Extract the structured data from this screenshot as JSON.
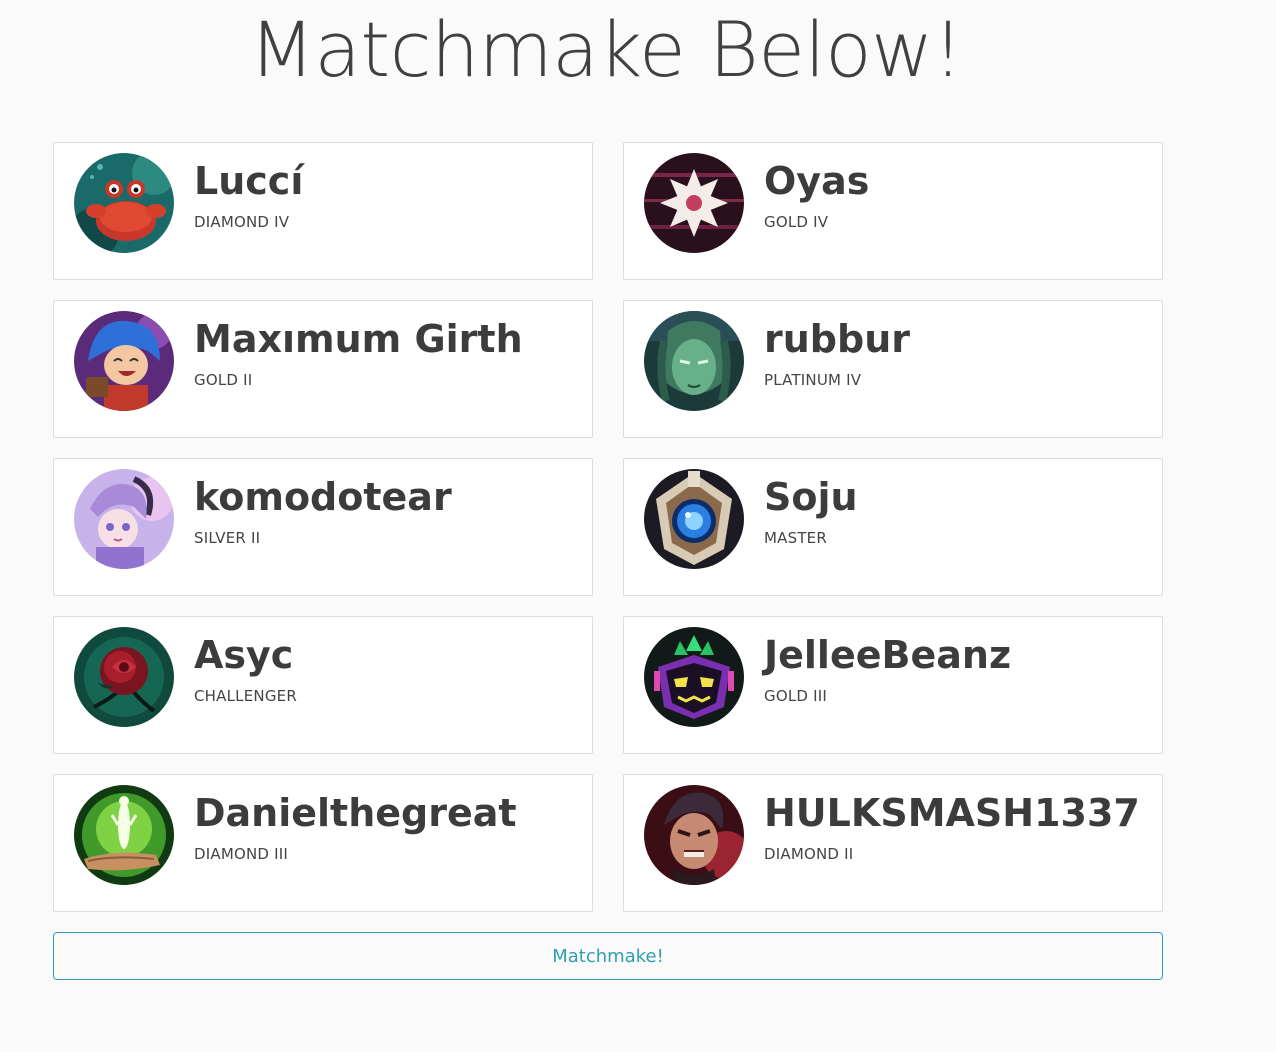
{
  "page": {
    "title": "Matchmake Below!",
    "accent_color": "#2e9fb4"
  },
  "players": [
    {
      "name": "Luccí",
      "rank": "DIAMOND IV",
      "icon": "crab-icon"
    },
    {
      "name": "Oyas",
      "rank": "GOLD IV",
      "icon": "sun-emblem-icon"
    },
    {
      "name": "Maxımum Girth",
      "rank": "GOLD II",
      "icon": "blue-hair-champion-icon"
    },
    {
      "name": "rubbur",
      "rank": "PLATINUM IV",
      "icon": "green-face-icon"
    },
    {
      "name": "komodotear",
      "rank": "SILVER II",
      "icon": "horned-girl-icon"
    },
    {
      "name": "Soju",
      "rank": "MASTER",
      "icon": "blue-orb-crest-icon"
    },
    {
      "name": "Asyc",
      "rank": "CHALLENGER",
      "icon": "red-rose-icon"
    },
    {
      "name": "JelleeBeanz",
      "rank": "GOLD III",
      "icon": "pixel-mask-icon"
    },
    {
      "name": "Danielthegreat",
      "rank": "DIAMOND III",
      "icon": "spirit-hand-icon"
    },
    {
      "name": "HULKSMASH1337",
      "rank": "DIAMOND II",
      "icon": "warrior-face-icon"
    }
  ],
  "actions": {
    "matchmake_label": "Matchmake!"
  }
}
